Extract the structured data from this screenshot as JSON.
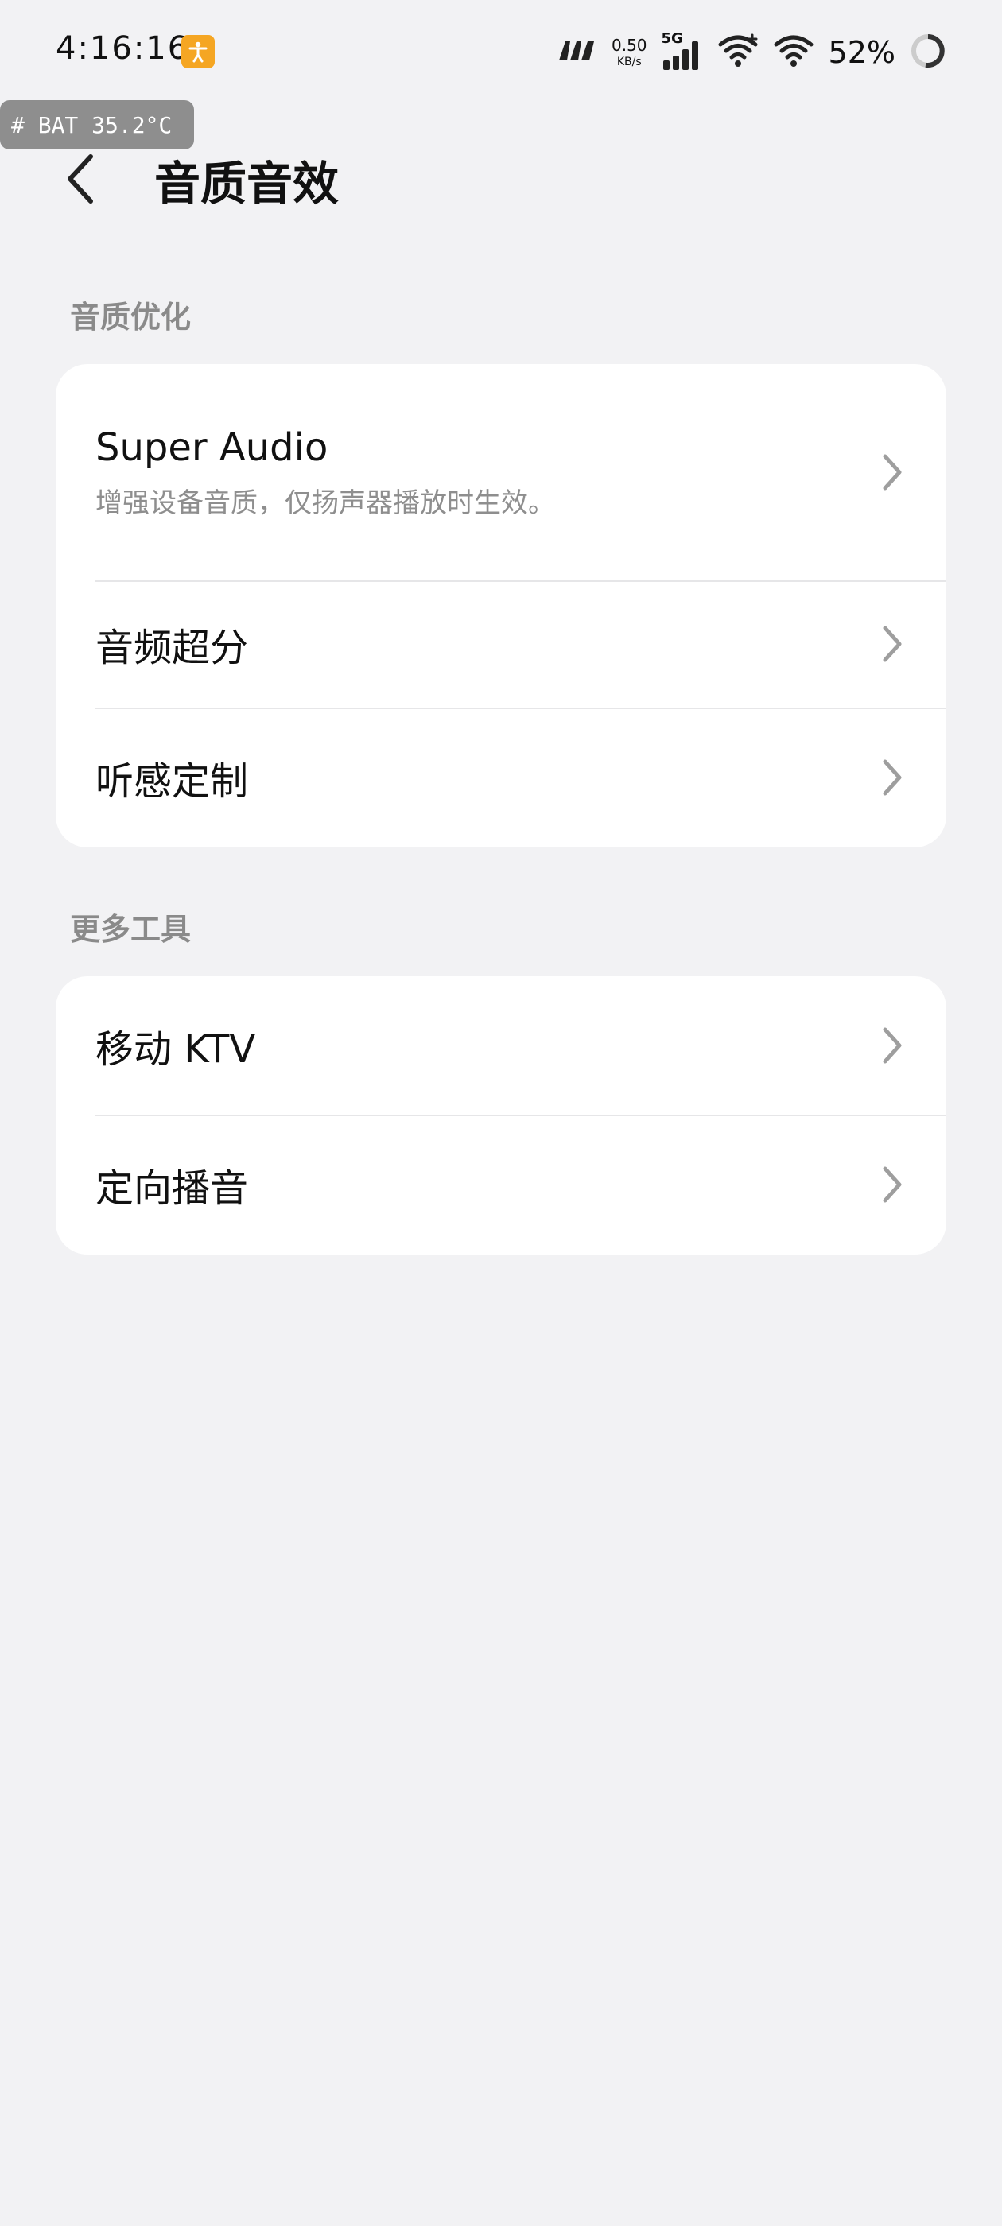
{
  "status_bar": {
    "time": "4:16:16",
    "net_speed_value": "0.50",
    "net_speed_unit": "KB/s",
    "network_type": "5G",
    "battery_percent": "52%",
    "icons": [
      "accessibility-icon",
      "m-brand-icon",
      "signal-icon",
      "wifi-plus-icon",
      "wifi-icon",
      "battery-ring-icon"
    ],
    "accent_color": "#F5A623"
  },
  "battery_badge": {
    "text": "# BAT 35.2°C"
  },
  "header": {
    "title": "音质音效",
    "back_icon": "back-chevron-icon"
  },
  "sections": [
    {
      "label": "音质优化",
      "items": [
        {
          "title": "Super Audio",
          "subtitle": "增强设备音质，仅扬声器播放时生效。"
        },
        {
          "title": "音频超分"
        },
        {
          "title": "听感定制"
        }
      ]
    },
    {
      "label": "更多工具",
      "items": [
        {
          "title": "移动 KTV"
        },
        {
          "title": "定向播音"
        }
      ]
    }
  ],
  "colors": {
    "background": "#F2F2F4",
    "card": "#FFFFFF",
    "section_label": "#8A8A8A",
    "chevron": "#9E9E9E"
  }
}
